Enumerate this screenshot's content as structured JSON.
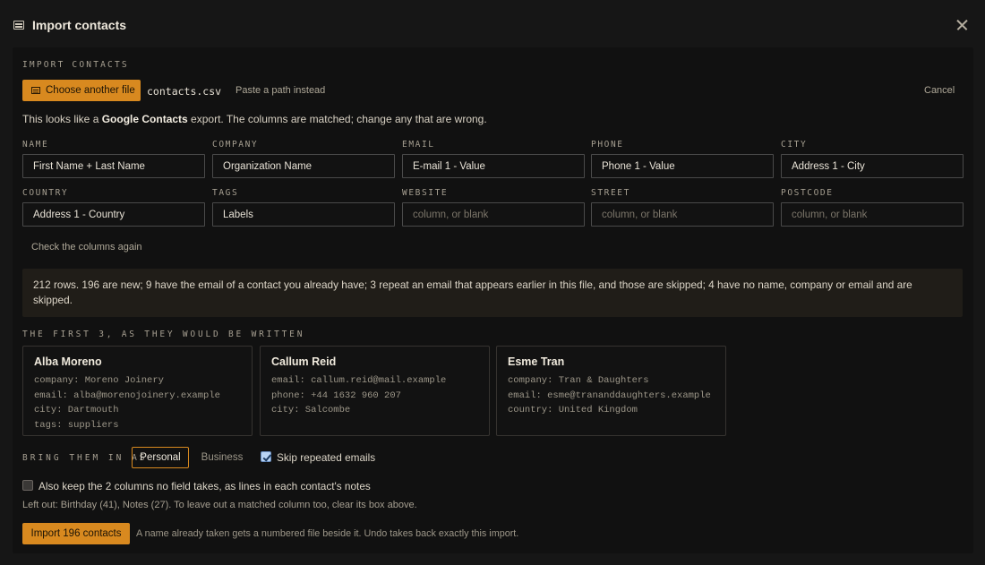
{
  "window": {
    "title": "Import contacts",
    "close_icon": "close-icon",
    "title_icon": "table-icon"
  },
  "import": {
    "section_label": "IMPORT CONTACTS",
    "choose_button": "Choose another file",
    "filename": "contacts.csv",
    "paste_link": "Paste a path instead",
    "cancel": "Cancel",
    "detect_prefix": "This looks like a ",
    "detect_source": "Google Contacts",
    "detect_suffix": " export. The columns are matched; change any that are wrong."
  },
  "fields": [
    {
      "label": "NAME",
      "value": "First Name + Last Name",
      "placeholder": ""
    },
    {
      "label": "COMPANY",
      "value": "Organization Name",
      "placeholder": ""
    },
    {
      "label": "EMAIL",
      "value": "E-mail 1 - Value",
      "placeholder": ""
    },
    {
      "label": "PHONE",
      "value": "Phone 1 - Value",
      "placeholder": ""
    },
    {
      "label": "CITY",
      "value": "Address 1 - City",
      "placeholder": ""
    },
    {
      "label": "COUNTRY",
      "value": "Address 1 - Country",
      "placeholder": ""
    },
    {
      "label": "TAGS",
      "value": "Labels",
      "placeholder": ""
    },
    {
      "label": "WEBSITE",
      "value": "",
      "placeholder": "column, or blank"
    },
    {
      "label": "STREET",
      "value": "",
      "placeholder": "column, or blank"
    },
    {
      "label": "POSTCODE",
      "value": "",
      "placeholder": "column, or blank"
    }
  ],
  "check_again": "Check the columns again",
  "summary": "212 rows. 196 are new; 9 have the email of a contact you already have; 3 repeat an email that appears earlier in this file, and those are skipped; 4 have no name, company or email and are skipped.",
  "preview": {
    "section_label": "THE FIRST 3, AS THEY WOULD BE WRITTEN",
    "cards": [
      {
        "name": "Alba Moreno",
        "lines": [
          "company: Moreno Joinery",
          "email: alba@morenojoinery.example",
          "city: Dartmouth",
          "tags: suppliers"
        ]
      },
      {
        "name": "Callum Reid",
        "lines": [
          "email: callum.reid@mail.example",
          "phone: +44 1632 960 207",
          "city: Salcombe"
        ]
      },
      {
        "name": "Esme Tran",
        "lines": [
          "company: Tran & Daughters",
          "email: esme@trananddaughters.example",
          "country: United Kingdom"
        ]
      }
    ]
  },
  "bring_in": {
    "section_label": "BRING THEM IN AS",
    "options": [
      "Personal",
      "Business"
    ],
    "selected": "Personal",
    "skip_repeated_label": "Skip repeated emails",
    "skip_repeated_checked": true
  },
  "notes_option": {
    "label": "Also keep the 2 columns no field takes, as lines in each contact's notes",
    "checked": false
  },
  "left_out": "Left out: Birthday (41), Notes (27). To leave out a matched column too, clear its box above.",
  "footer": {
    "import_button": "Import 196 contacts",
    "note": "A name already taken gets a numbered file beside it. Undo takes back exactly this import."
  },
  "colors": {
    "accent": "#d8891f",
    "background": "#161616",
    "panel": "#111111"
  }
}
